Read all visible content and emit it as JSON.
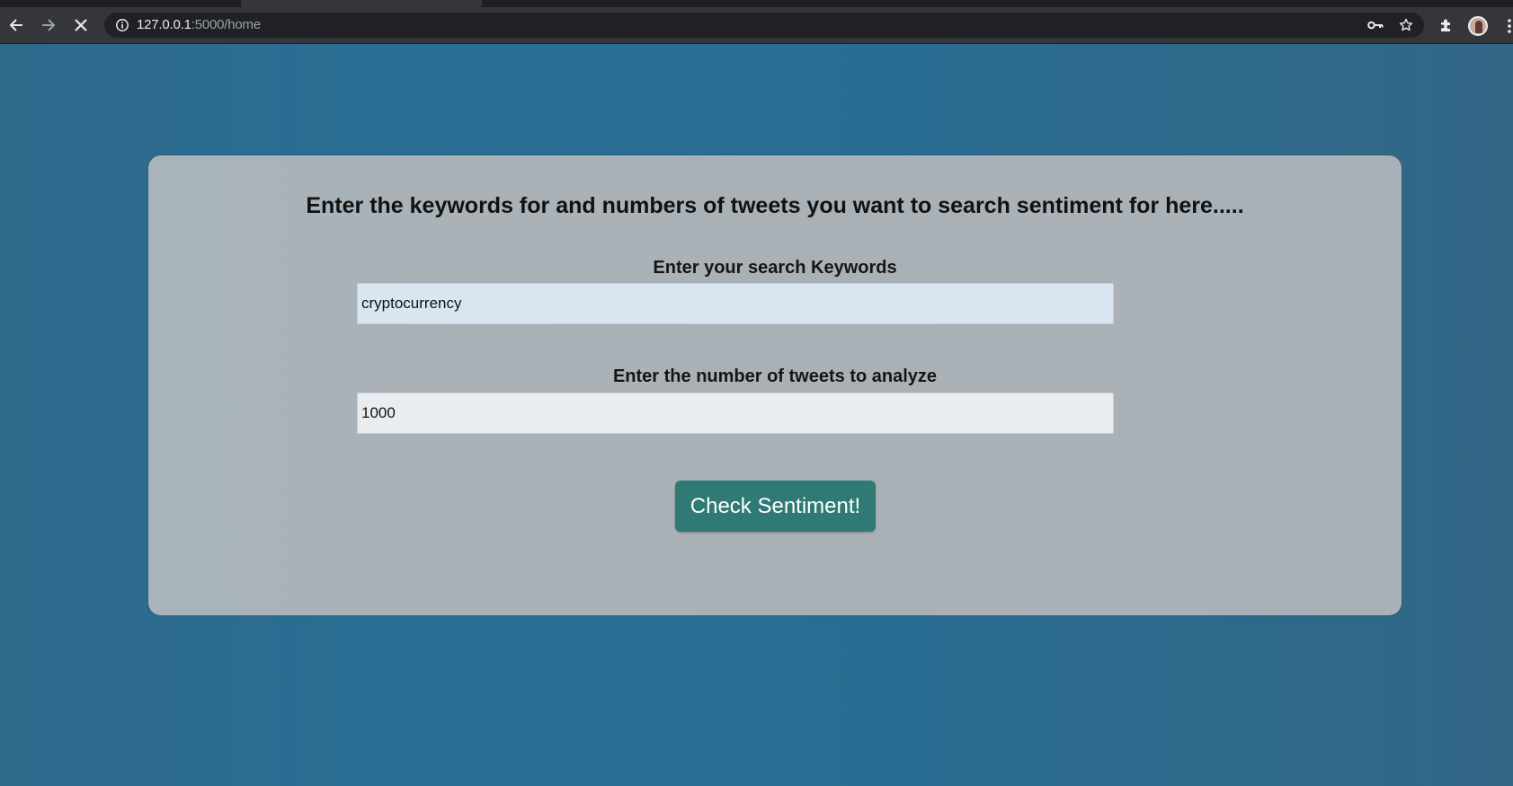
{
  "browser": {
    "url_host": "127.0.0.1",
    "url_path": ":5000/home"
  },
  "icons": {
    "back": "arrow-left-icon",
    "forward": "arrow-right-icon",
    "stop": "close-icon",
    "site_info": "info-icon",
    "password_key": "key-icon",
    "bookmark": "star-icon",
    "extensions": "puzzle-icon",
    "profile": "avatar",
    "menu": "more-vert-icon"
  },
  "page": {
    "heading": "Enter the keywords for and numbers of tweets you want to search sentiment for here.....",
    "keywords_label": "Enter your search Keywords",
    "keywords_value": "cryptocurrency",
    "count_label": "Enter the number of tweets to analyze",
    "count_value": "1000",
    "submit_label": "Check Sentiment!"
  },
  "colors": {
    "page_background": "#2a6d92",
    "card_background": "#aab1b6",
    "button_background": "#2f7a74",
    "keywords_input_background": "#d9e6f2",
    "count_input_background": "#e9edf0"
  }
}
